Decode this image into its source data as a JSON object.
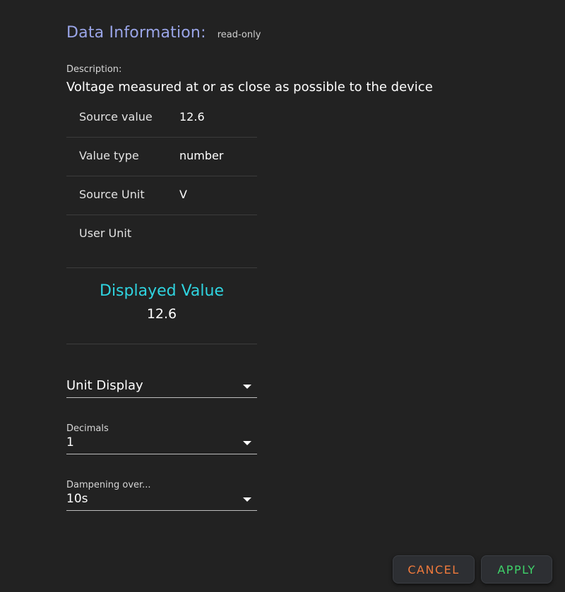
{
  "header": {
    "title": "Data Information:",
    "subtitle": "read-only"
  },
  "description": {
    "label": "Description:",
    "text": "Voltage measured at or as close as possible to the device"
  },
  "info": {
    "source_value_label": "Source value",
    "source_value": "12.6",
    "value_type_label": "Value type",
    "value_type": "number",
    "source_unit_label": "Source Unit",
    "source_unit": "V",
    "user_unit_label": "User Unit",
    "user_unit": ""
  },
  "displayed": {
    "title": "Displayed Value",
    "value": "12.6"
  },
  "unit_display": {
    "label": "",
    "value": "Unit Display"
  },
  "decimals": {
    "label": "Decimals",
    "value": "1"
  },
  "dampening": {
    "label": "Dampening over...",
    "value": "10s"
  },
  "buttons": {
    "cancel": "CANCEL",
    "apply": "APPLY"
  },
  "colors": {
    "header_accent": "#9aa5e8",
    "displayed_accent": "#2fd4e0",
    "cancel": "#f07a3c",
    "apply": "#3fd36a",
    "background": "#222222"
  }
}
